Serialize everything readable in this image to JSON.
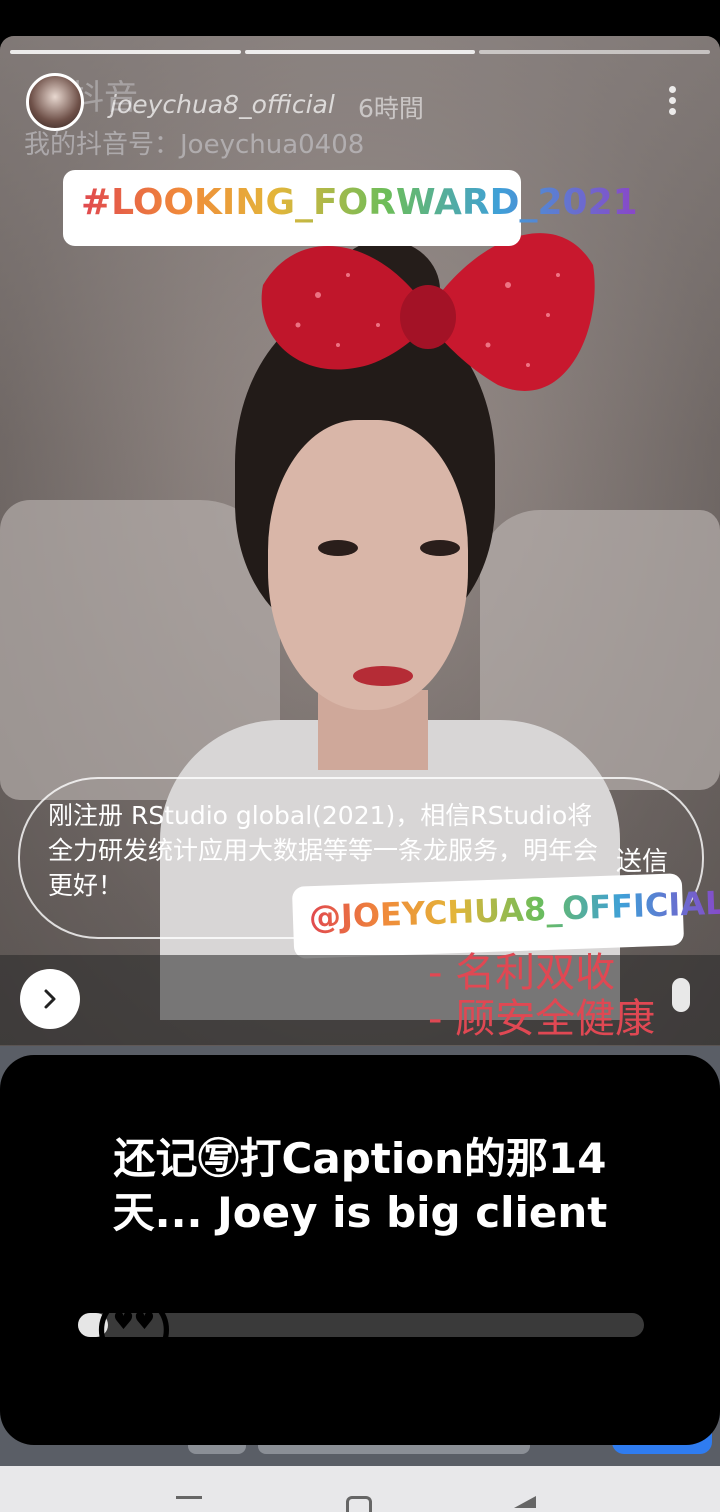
{
  "header": {
    "watermark": "抖音",
    "username": "joeychua8_official",
    "time_ago": "6時間",
    "douyin_id": "我的抖音号：Joeychua0408"
  },
  "stickers": {
    "hashtag": "#LOOKING_FORWARD_2021",
    "mention": "@JOEYCHUA8_OFFICIAL"
  },
  "caption": {
    "text": "刚注册 RStudio global(2021)，相信RStudio将全力研发统计应用大数据等等一条龙服务，明年会更好！",
    "send": "送信"
  },
  "overlay_text": {
    "line1": "- 名利双收",
    "line2": "- 顾安全健康"
  },
  "poll": {
    "question": "还记㊢打Caption的那14天... Joey is big client",
    "emoji": "😍",
    "slider_level": 0
  },
  "colors": {
    "accent_red": "#e04853",
    "rainbow": [
      "#e0484f",
      "#f08a3a",
      "#e3b53a",
      "#6cbd5a",
      "#3fa0d8",
      "#8a46c8"
    ]
  }
}
